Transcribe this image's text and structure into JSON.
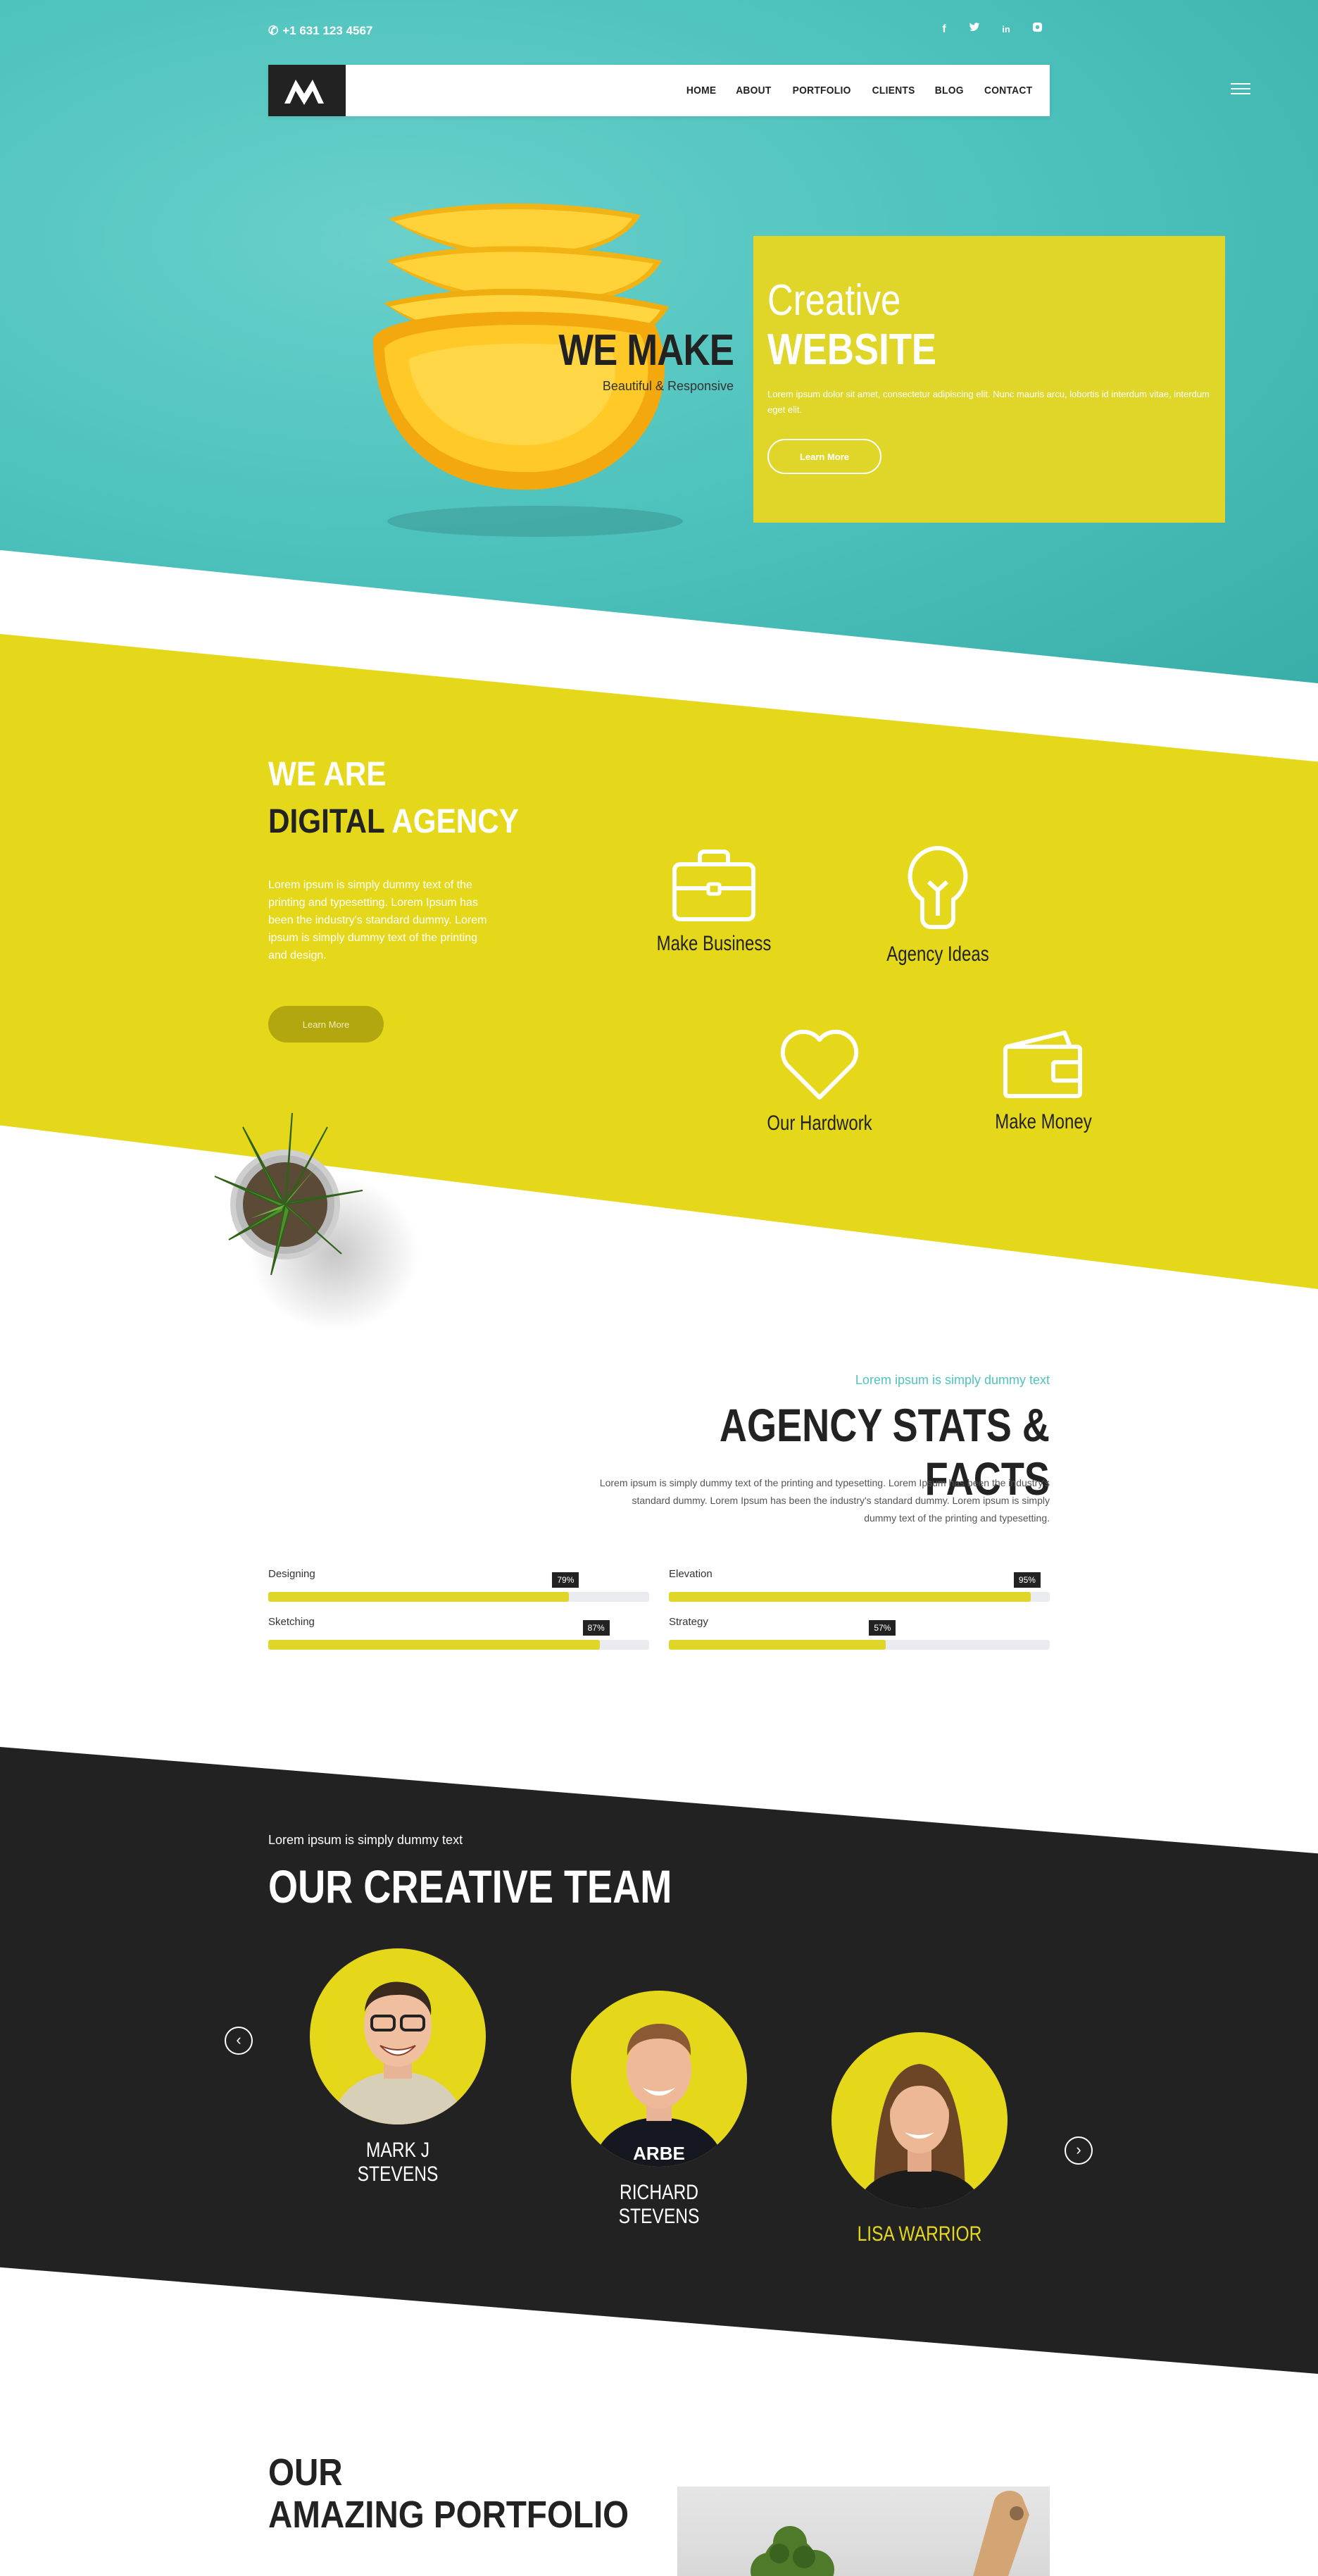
{
  "header": {
    "phone": "+1 631 123 4567",
    "social": [
      {
        "icon": "facebook-icon",
        "glyph": "f"
      },
      {
        "icon": "twitter-icon",
        "glyph": "t"
      },
      {
        "icon": "linkedin-icon",
        "glyph": "in"
      },
      {
        "icon": "instagram-icon",
        "glyph": "◘"
      }
    ],
    "nav": [
      "HOME",
      "ABOUT",
      "PORTFOLIO",
      "CLIENTS",
      "BLOG",
      "CONTACT"
    ]
  },
  "hero": {
    "we_make": "WE MAKE",
    "tagline": "Beautiful & Responsive",
    "creative": "Creative",
    "website": "WEBSITE",
    "description": "Lorem ipsum dolor sit amet, consectetur adipiscing elit. Nunc mauris arcu, lobortis id interdum vitae, interdum eget elit.",
    "button": "Learn More"
  },
  "agency": {
    "we_are": "WE ARE",
    "digital": "DIGITAL",
    "agency": "AGENCY",
    "description": "Lorem ipsum is simply dummy text of the printing and typesetting. Lorem Ipsum has been the industry's standard dummy. Lorem ipsum is simply dummy text of the printing and design.",
    "button": "Learn More",
    "features": [
      {
        "label": "Make Business",
        "icon": "briefcase-icon"
      },
      {
        "label": "Agency Ideas",
        "icon": "lightbulb-icon"
      },
      {
        "label": "Our Hardwork",
        "icon": "heart-icon"
      },
      {
        "label": "Make Money",
        "icon": "wallet-icon"
      }
    ]
  },
  "stats": {
    "subtitle": "Lorem ipsum is simply dummy text",
    "title": "AGENCY STATS & FACTS",
    "description": "Lorem ipsum is simply dummy text of the printing and typesetting. Lorem Ipsum has been the industry's standard dummy. Lorem Ipsum has been the industry's standard dummy. Lorem ipsum is simply dummy text of the printing and typesetting.",
    "skills": [
      {
        "name": "Designing",
        "percent": 79,
        "label": "79%"
      },
      {
        "name": "Elevation",
        "percent": 95,
        "label": "95%"
      },
      {
        "name": "Sketching",
        "percent": 87,
        "label": "87%"
      },
      {
        "name": "Strategy",
        "percent": 57,
        "label": "57%"
      }
    ]
  },
  "team": {
    "subtitle": "Lorem ipsum is simply dummy text",
    "title": "OUR CREATIVE TEAM",
    "members": [
      {
        "name": "MARK J STEVENS"
      },
      {
        "name": "RICHARD STEVENS"
      },
      {
        "name": "LISA WARRIOR"
      }
    ],
    "prev_glyph": "‹",
    "next_glyph": "›"
  },
  "portfolio": {
    "line1": "OUR",
    "line2": "AMAZING PORTFOLIO"
  },
  "colors": {
    "accent_yellow": "#e5d81a",
    "teal": "#4fc3bd",
    "dark": "#222222"
  }
}
